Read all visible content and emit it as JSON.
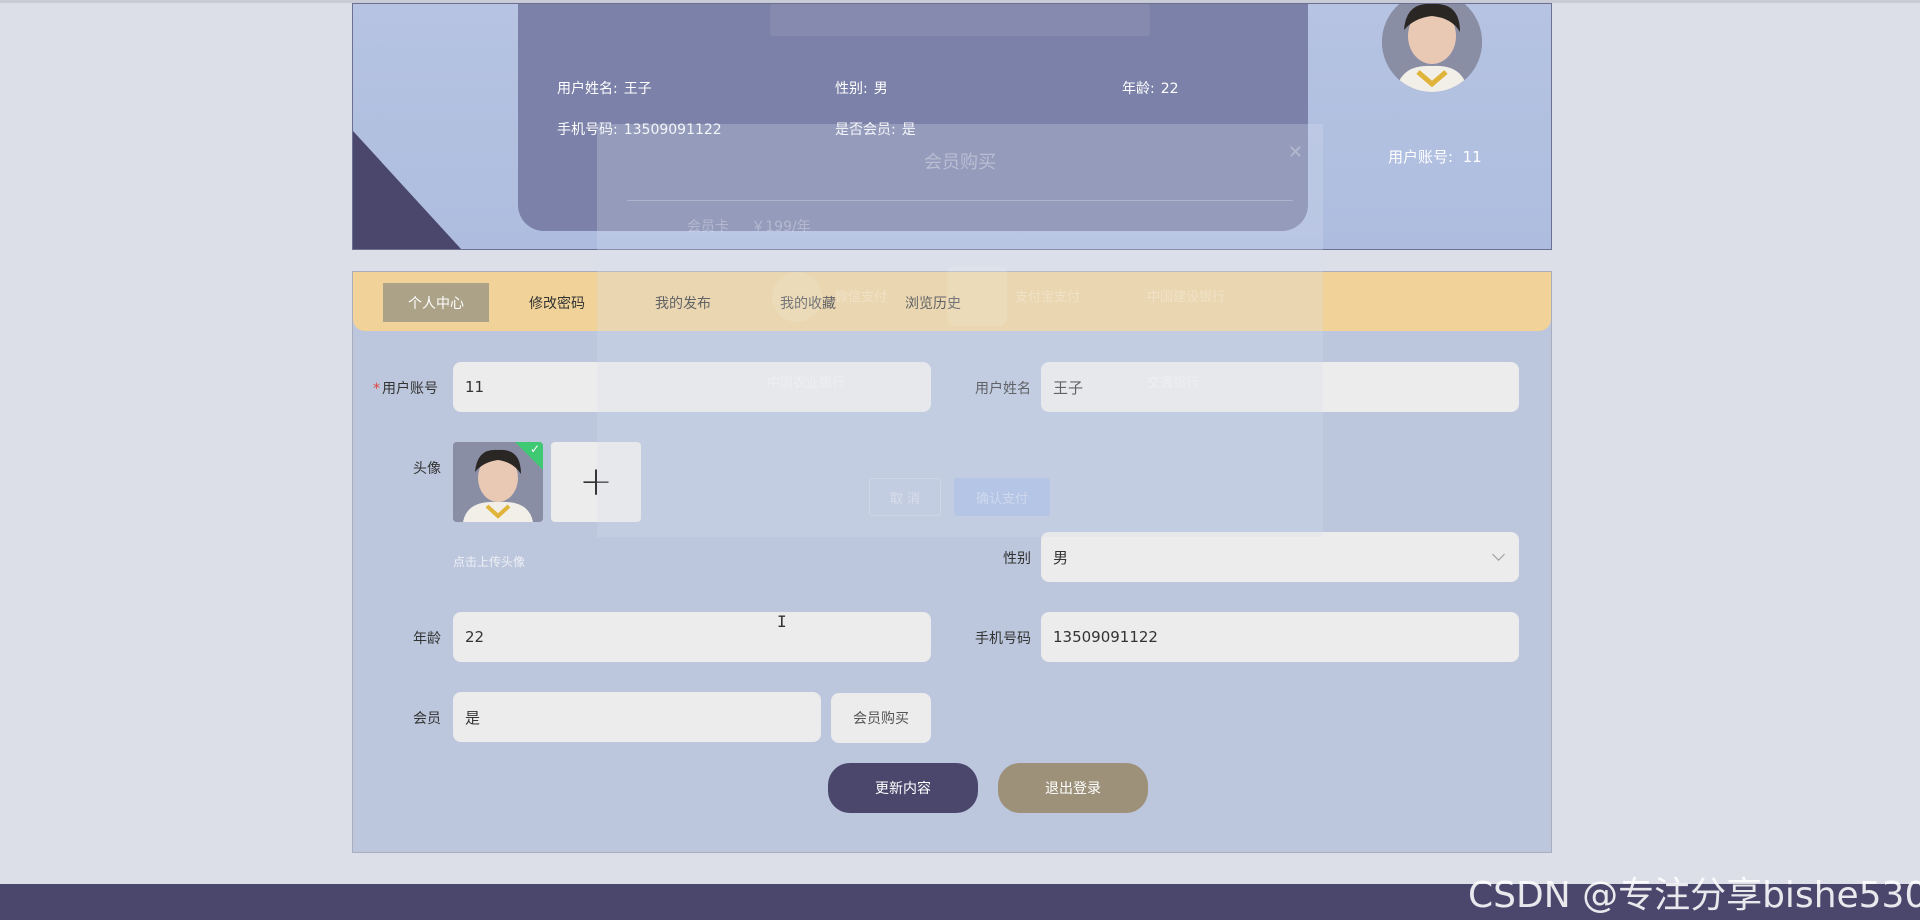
{
  "header": {
    "user_name_label": "用户姓名:",
    "user_name": "王子",
    "gender_label": "性别:",
    "gender": "男",
    "age_label": "年龄:",
    "age": "22",
    "phone_label": "手机号码:",
    "phone": "13509091122",
    "member_label": "是否会员:",
    "member": "是",
    "account_label": "用户账号:",
    "account": "11"
  },
  "tabs": [
    {
      "label": "个人中心",
      "active": true
    },
    {
      "label": "修改密码",
      "active": false
    },
    {
      "label": "我的发布",
      "active": false
    },
    {
      "label": "我的收藏",
      "active": false
    },
    {
      "label": "浏览历史",
      "active": false
    }
  ],
  "form": {
    "account_label": "用户账号",
    "account_value": "11",
    "name_label": "用户姓名",
    "name_value": "王子",
    "avatar_label": "头像",
    "upload_hint": "点击上传头像",
    "gender_label": "性别",
    "gender_value": "男",
    "age_label": "年龄",
    "age_value": "22",
    "phone_label": "手机号码",
    "phone_value": "13509091122",
    "member_label": "会员",
    "member_value": "是",
    "buy_member_button": "会员购买",
    "update_button": "更新内容",
    "logout_button": "退出登录"
  },
  "modal": {
    "title": "会员购买",
    "card_label": "会员卡",
    "price": "￥199/年",
    "options": [
      "微信支付",
      "支付宝支付",
      "中国建设银行",
      "中国农业银行",
      "交通银行"
    ],
    "cancel_button": "取 消",
    "confirm_button": "确认支付"
  },
  "watermark": "CSDN @专注分享bishe530",
  "colors": {
    "accent_dark": "#4a466c",
    "tab_bar": "#f1d399",
    "tab_active": "#aba287",
    "logout": "#9d9179"
  }
}
